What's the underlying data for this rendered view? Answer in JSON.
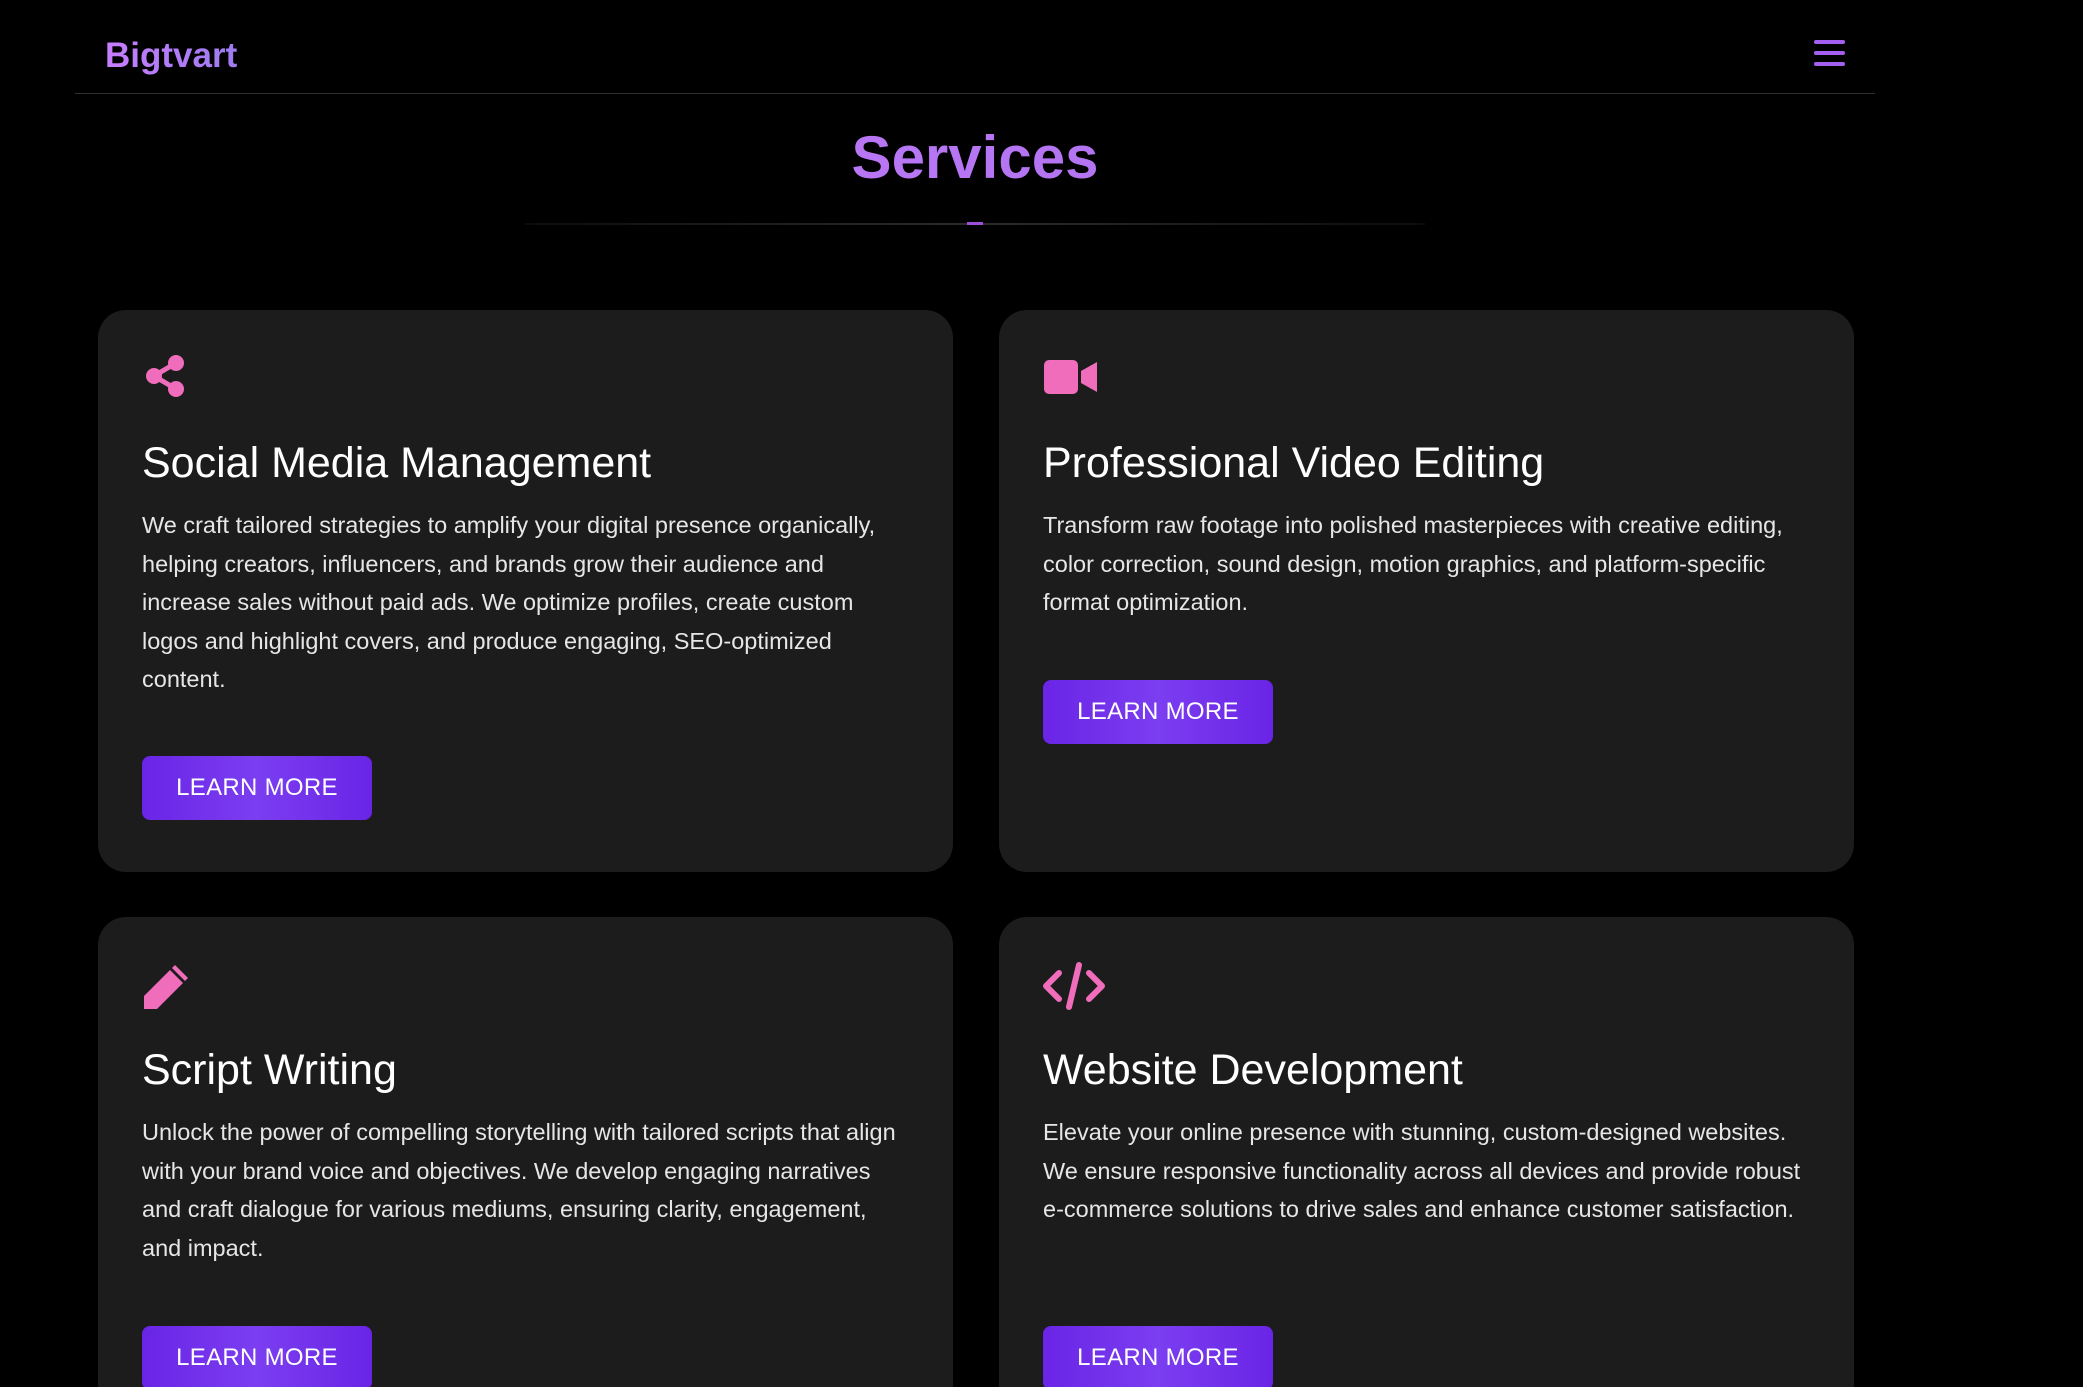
{
  "brand": {
    "name": "Bigtvart"
  },
  "header": {
    "menu_icon": "hamburger-menu-icon"
  },
  "section": {
    "title": "Services"
  },
  "services": [
    {
      "icon": "share-icon",
      "title": "Social Media Management",
      "description": "We craft tailored strategies to amplify your digital presence organically, helping creators, influencers, and brands grow their audience and increase sales without paid ads. We optimize profiles, create custom logos and highlight covers, and produce engaging, SEO-optimized content.",
      "button": "LEARN MORE"
    },
    {
      "icon": "video-camera-icon",
      "title": "Professional Video Editing",
      "description": "Transform raw footage into polished masterpieces with creative editing, color correction, sound design, motion graphics, and platform-specific format optimization.",
      "button": "LEARN MORE"
    },
    {
      "icon": "pencil-icon",
      "title": "Script Writing",
      "description": "Unlock the power of compelling storytelling with tailored scripts that align with your brand voice and objectives. We develop engaging narratives and craft dialogue for various mediums, ensuring clarity, engagement, and impact.",
      "button": "LEARN MORE"
    },
    {
      "icon": "code-icon",
      "title": "Website Development",
      "description": "Elevate your online presence with stunning, custom-designed websites. We ensure responsive functionality across all devices and provide robust e-commerce solutions to drive sales and enhance customer satisfaction.",
      "button": "LEARN MORE"
    }
  ],
  "colors": {
    "background": "#000000",
    "card": "#1c1c1d",
    "icon_pink": "#f06dbb",
    "accent_purple": "#6a24e6",
    "title_gradient": "#c77dff"
  }
}
